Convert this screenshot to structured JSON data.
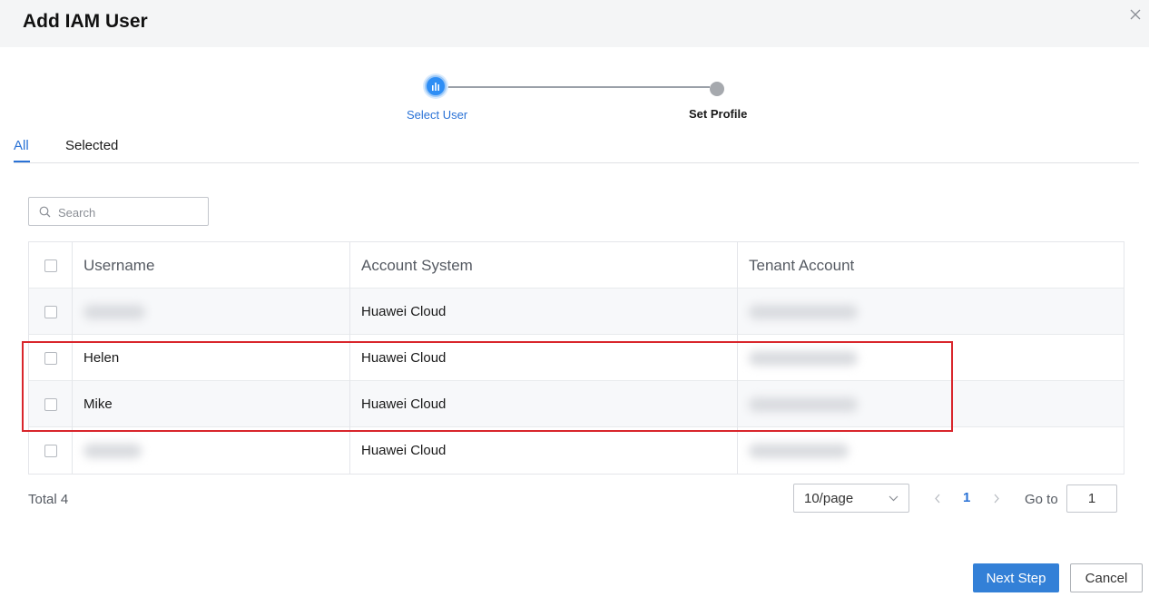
{
  "dialog": {
    "title": "Add IAM User",
    "close_icon": "close-icon"
  },
  "steps": [
    {
      "label": "Select User",
      "state": "active",
      "icon": "bar-chart-icon"
    },
    {
      "label": "Set Profile",
      "state": "pending"
    }
  ],
  "tabs": [
    {
      "label": "All",
      "active": true
    },
    {
      "label": "Selected",
      "active": false
    }
  ],
  "search": {
    "placeholder": "Search",
    "value": "",
    "icon": "search-icon"
  },
  "table": {
    "columns": [
      "Username",
      "Account System",
      "Tenant Account"
    ],
    "rows": [
      {
        "username": "",
        "username_redacted": true,
        "account_system": "Huawei Cloud",
        "tenant_account_redacted": true
      },
      {
        "username": "Helen",
        "username_redacted": false,
        "account_system": "Huawei Cloud",
        "tenant_account_redacted": true
      },
      {
        "username": "Mike",
        "username_redacted": false,
        "account_system": "Huawei Cloud",
        "tenant_account_redacted": true
      },
      {
        "username": "",
        "username_redacted": true,
        "account_system": "Huawei Cloud",
        "tenant_account_redacted": true
      }
    ]
  },
  "pagination": {
    "total": "Total 4",
    "page_size": "10/page",
    "current_page": "1",
    "goto_label": "Go to",
    "goto_value": "1"
  },
  "footer": {
    "next_label": "Next Step",
    "cancel_label": "Cancel"
  },
  "colors": {
    "primary": "#3380d7",
    "link": "#2a72d6",
    "highlight": "#d9262c",
    "header_bg": "#f4f5f6"
  }
}
